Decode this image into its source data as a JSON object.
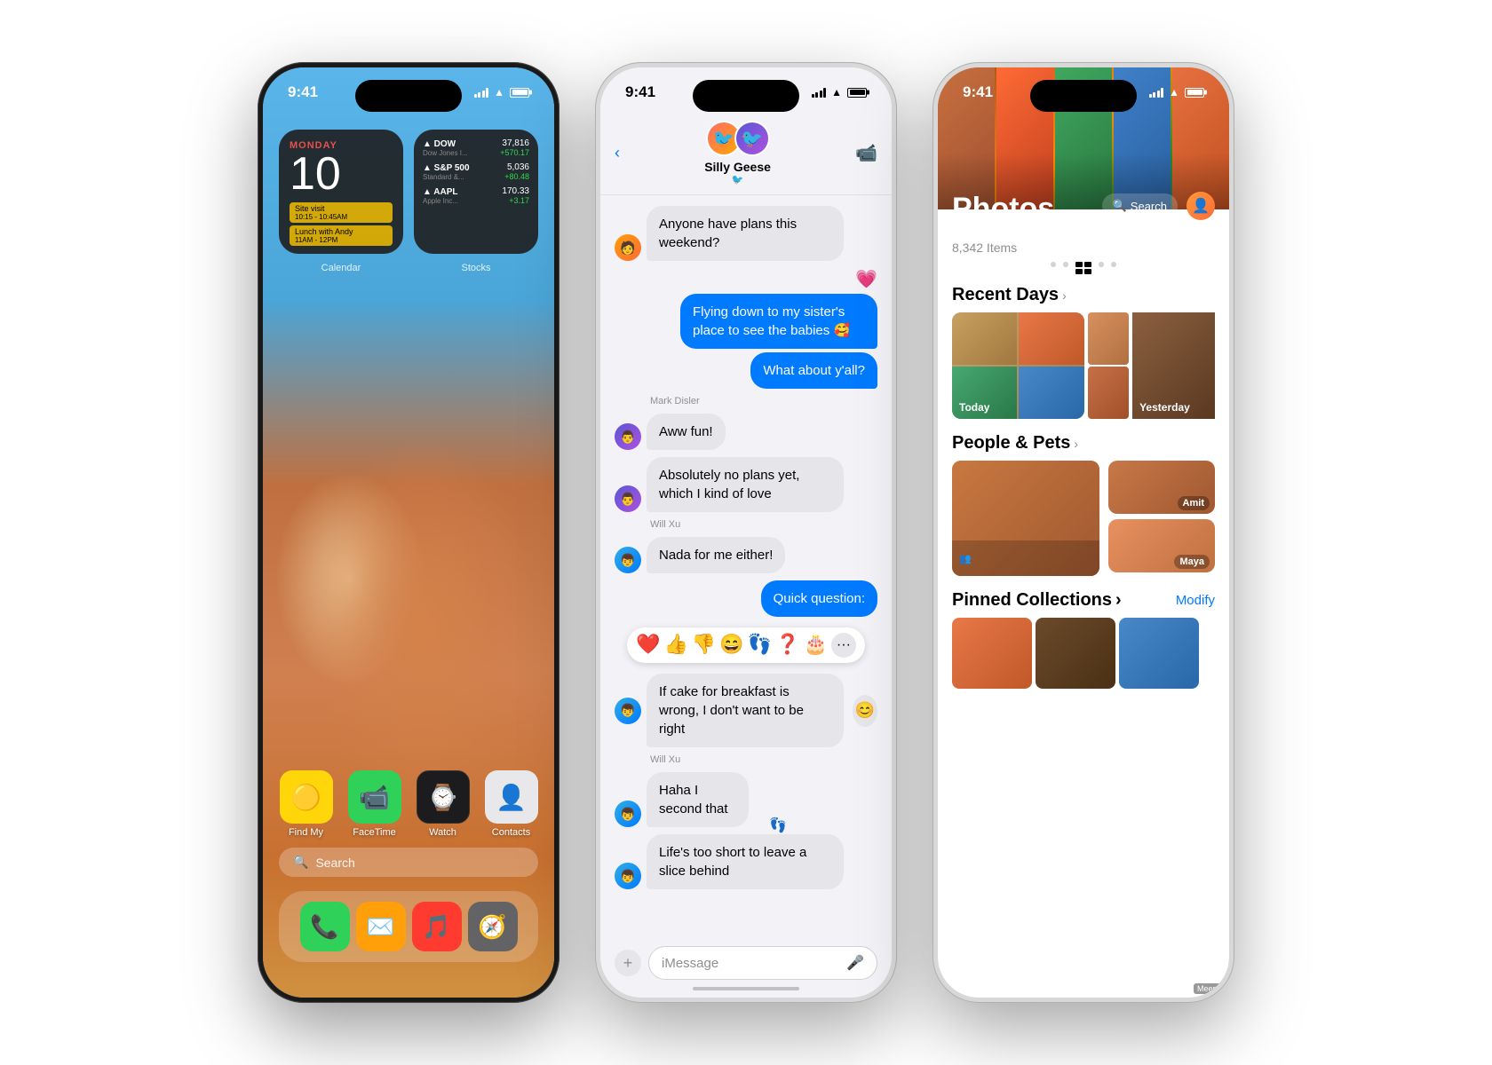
{
  "phone1": {
    "status_time": "9:41",
    "widget_calendar": {
      "day": "MONDAY",
      "date": "10",
      "events": [
        {
          "text": "Site visit",
          "sub": "10:15 - 10:45AM"
        },
        {
          "text": "Lunch with Andy",
          "sub": "11AM - 12PM"
        }
      ],
      "label": "Calendar"
    },
    "widget_stocks": {
      "items": [
        {
          "name": "DOW",
          "sub": "Dow Jones I...",
          "price": "37,816",
          "change": "+570.17"
        },
        {
          "name": "S&P 500",
          "sub": "Standard &...",
          "price": "5,036",
          "change": "+80.48"
        },
        {
          "name": "AAPL",
          "sub": "Apple Inc...",
          "price": "170.33",
          "change": "+3.17"
        }
      ],
      "label": "Stocks"
    },
    "apps": [
      {
        "label": "Find My",
        "icon": "🟡",
        "bg": "#FFD60A"
      },
      {
        "label": "FaceTime",
        "icon": "📹",
        "bg": "#30D158"
      },
      {
        "label": "Watch",
        "icon": "⌚",
        "bg": "#1c1c1e"
      },
      {
        "label": "Contacts",
        "icon": "👤",
        "bg": "#e8e8e8"
      }
    ],
    "search_placeholder": "Search",
    "dock_apps": [
      {
        "icon": "📞",
        "bg": "#30D158"
      },
      {
        "icon": "✉️",
        "bg": "#FF9F0A"
      },
      {
        "icon": "🎵",
        "bg": "#FF3B30"
      },
      {
        "icon": "🧭",
        "bg": "#636366"
      }
    ]
  },
  "phone2": {
    "status_time": "9:41",
    "contact_name": "Silly Geese",
    "contact_sub": "🐦",
    "messages": [
      {
        "side": "left",
        "text": "Anyone have plans this weekend?",
        "avatar": "🧑"
      },
      {
        "side": "right",
        "text": "Flying down to my sister's place to see the babies 🥰"
      },
      {
        "side": "right",
        "text": "What about y'all?"
      },
      {
        "sender": "Mark Disler",
        "side": "left",
        "text": "Aww fun!",
        "avatar": "👨"
      },
      {
        "sender": "",
        "side": "left",
        "text": "Absolutely no plans yet, which I kind of love",
        "avatar": "👨"
      },
      {
        "sender": "Will Xu",
        "side": "left",
        "text": "Nada for me either!",
        "avatar": "👦"
      },
      {
        "side": "right",
        "text": "Quick question:",
        "highlight": true
      },
      {
        "side": "tapback",
        "emojis": [
          "❤️",
          "👍",
          "👎",
          "😄",
          "👣",
          "❓",
          "🎂"
        ]
      },
      {
        "side": "left",
        "text": "If cake for breakfast is wrong, I don't want to be right",
        "avatar": "👦"
      },
      {
        "sender": "Will Xu",
        "side": "left",
        "text": "Haha I second that",
        "avatar": "👦",
        "reaction": "👣"
      },
      {
        "side": "left",
        "text": "Life's too short to leave a slice behind",
        "avatar": "👦"
      }
    ],
    "input_placeholder": "iMessage"
  },
  "phone3": {
    "status_time": "9:41",
    "title": "Photos",
    "count": "8,342 Items",
    "search_label": "Search",
    "sections": {
      "recent_days": {
        "title": "Recent Days",
        "today_label": "Today",
        "yesterday_label": "Yesterday"
      },
      "people_pets": {
        "title": "People & Pets",
        "people": [
          {
            "label": "Amit"
          },
          {
            "label": "Maya"
          }
        ]
      },
      "pinned": {
        "title": "Pinned Collections",
        "modify_label": "Modify"
      }
    }
  }
}
